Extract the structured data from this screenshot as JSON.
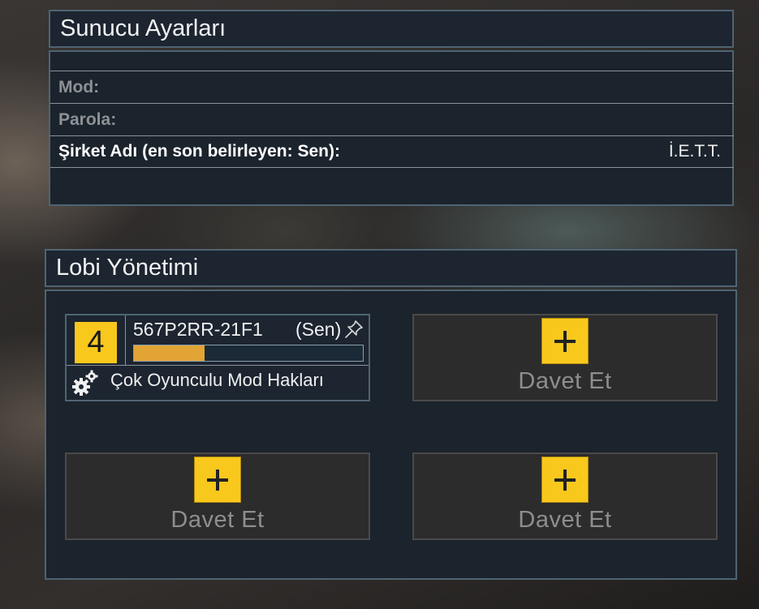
{
  "server_settings": {
    "title": "Sunucu Ayarları",
    "mode_label": "Mod:",
    "password_label": "Parola:",
    "company_label": "Şirket Adı (en son belirleyen: Sen):",
    "company_value": "İ.E.T.T."
  },
  "lobby": {
    "title": "Lobi Yönetimi",
    "player": {
      "slot_number": "4",
      "id": "567P2RR-21F1",
      "you_label": "(Sen)",
      "progress": 0.31,
      "permission_label": "Çok Oyunculu Mod Hakları",
      "pin_icon": "pin-icon",
      "permissions_icon": "gears-icon"
    },
    "invite_slots": [
      {
        "label": "Davet Et"
      },
      {
        "label": "Davet Et"
      },
      {
        "label": "Davet Et"
      }
    ]
  },
  "colors": {
    "accent": "#f9c81c",
    "progress": "#e3a436",
    "panel_border": "#4f6472"
  }
}
